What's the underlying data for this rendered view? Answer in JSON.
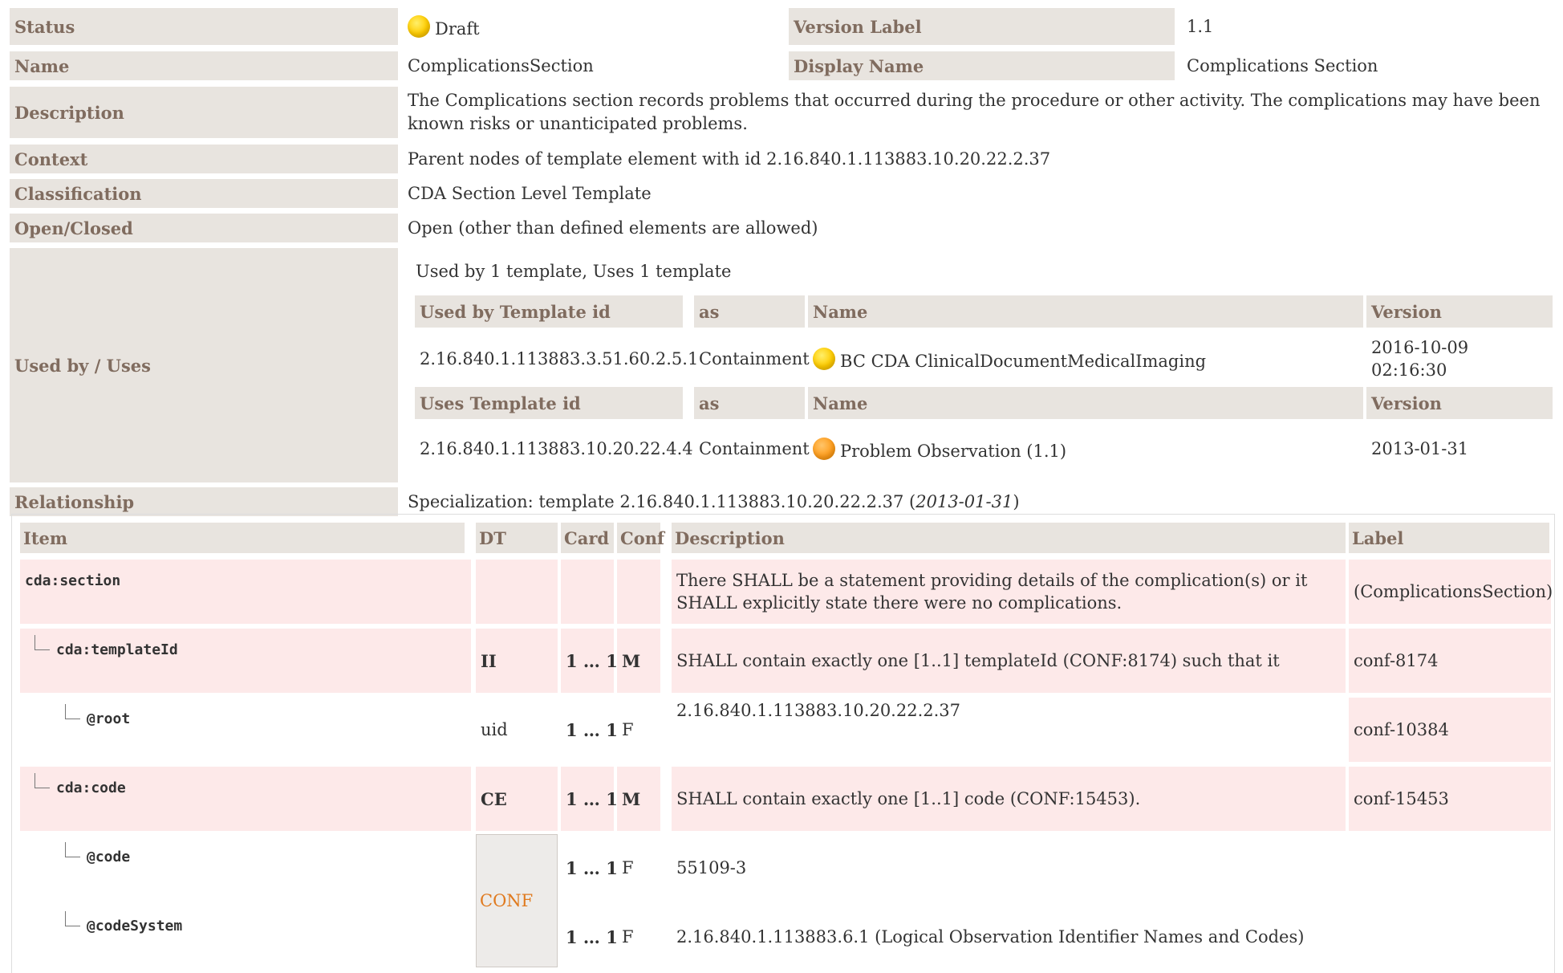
{
  "meta": {
    "status_label": "Status",
    "status_value": "Draft",
    "version_label": "Version Label",
    "version_value": "1.1",
    "name_label": "Name",
    "name_value": "ComplicationsSection",
    "display_name_label": "Display Name",
    "display_name_value": "Complications Section",
    "description_label": "Description",
    "description_value": "The Complications section records problems that occurred during the procedure or other activity. The complications may have been known risks or unanticipated problems.",
    "context_label": "Context",
    "context_value": "Parent nodes of template element with id 2.16.840.1.113883.10.20.22.2.37",
    "classification_label": "Classification",
    "classification_value": "CDA Section Level Template",
    "open_closed_label": "Open/Closed",
    "open_closed_value": "Open (other than defined elements are allowed)",
    "used_by_label": "Used by / Uses",
    "used_by_summary": "Used by 1 template, Uses 1 template",
    "relationship_label": "Relationship",
    "relationship_prefix": "Specialization: template 2.16.840.1.113883.10.20.22.2.37 (",
    "relationship_date": "2013-01-31",
    "relationship_suffix": ")"
  },
  "used_by_table": {
    "headers": [
      "Used by Template id",
      "as",
      "Name",
      "Version"
    ],
    "row": {
      "id": "2.16.840.1.113883.3.51.60.2.5.1",
      "as": "Containment",
      "name": "BC CDA ClinicalDocumentMedicalImaging",
      "version_line1": "2016-10-09",
      "version_line2": "02:16:30",
      "status_color": "yellow"
    }
  },
  "uses_table": {
    "headers": [
      "Uses Template id",
      "as",
      "Name",
      "Version"
    ],
    "row": {
      "id": "2.16.840.1.113883.10.20.22.4.4",
      "as": "Containment",
      "name": "Problem Observation (1.1)",
      "version": "2013-01-31",
      "status_color": "orange"
    }
  },
  "grid": {
    "headers": {
      "item": "Item",
      "dt": "DT",
      "card": "Card",
      "conf": "Conf",
      "description": "Description",
      "label": "Label"
    },
    "rows": [
      {
        "item": "cda:section",
        "dt": "",
        "card": "",
        "conf": "",
        "description": "There SHALL be a statement providing details of the complication(s) or it SHALL explicitly state there were no complications.",
        "label": "(ComplicationsSection)"
      },
      {
        "item": "cda:templateId",
        "dt": "II",
        "card": "1 … 1",
        "conf": "M",
        "description": "SHALL contain exactly one [1..1] templateId (CONF:8174) such that it",
        "label": "conf-8174"
      },
      {
        "item": "@root",
        "dt": "uid",
        "card": "1 … 1",
        "conf": "F",
        "description": "2.16.840.1.113883.10.20.22.2.37",
        "label": "conf-10384"
      },
      {
        "item": "cda:code",
        "dt": "CE",
        "card": "1 … 1",
        "conf": "M",
        "description": "SHALL contain exactly one [1..1] code (CONF:15453).",
        "label": "conf-15453"
      },
      {
        "item": "@code",
        "dt": "CONF",
        "card": "1 … 1",
        "conf": "F",
        "description": "55109-3",
        "label": ""
      },
      {
        "item": "@codeSystem",
        "dt": "",
        "card": "1 … 1",
        "conf": "F",
        "description": "2.16.840.1.113883.6.1 (Logical Observation Identifier Names and Codes)",
        "label": ""
      }
    ]
  },
  "colors": {
    "header_bg": "#e8e4df",
    "header_text": "#806c5f",
    "pink_row": "#fde9e9",
    "conf_text": "#e07a1f"
  }
}
